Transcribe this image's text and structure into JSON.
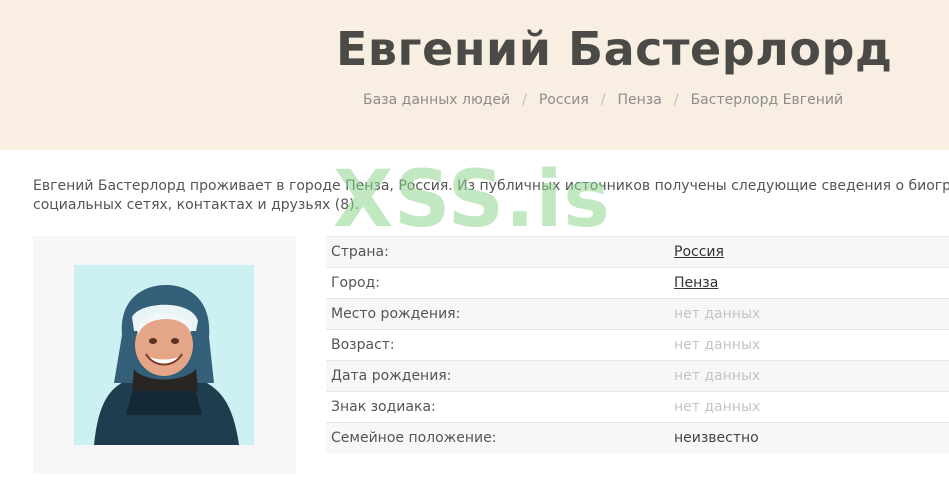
{
  "header": {
    "title": "Евгений Бастерлорд",
    "breadcrumb": [
      "База данных людей",
      "Россия",
      "Пенза",
      "Бастерлорд Евгений"
    ]
  },
  "intro": {
    "line1": "Евгений Бастерлорд проживает в городе Пенза, Россия. Из публичных источников получены следующие сведения о биогра",
    "line2": "социальных сетях, контактах и друзьях (8)."
  },
  "watermark": "XSS.is",
  "profile": {
    "photo_alt": "avatar",
    "rows": [
      {
        "label": "Страна:",
        "value": "Россия",
        "link": true
      },
      {
        "label": "Город:",
        "value": "Пенза",
        "link": true
      },
      {
        "label": "Место рождения:",
        "value": "нет данных",
        "link": false,
        "nodata": true
      },
      {
        "label": "Возраст:",
        "value": "нет данных",
        "link": false,
        "nodata": true
      },
      {
        "label": "Дата рождения:",
        "value": "нет данных",
        "link": false,
        "nodata": true
      },
      {
        "label": "Знак зодиака:",
        "value": "нет данных",
        "link": false,
        "nodata": true
      },
      {
        "label": "Семейное положение:",
        "value": "неизвестно",
        "link": false
      }
    ]
  }
}
